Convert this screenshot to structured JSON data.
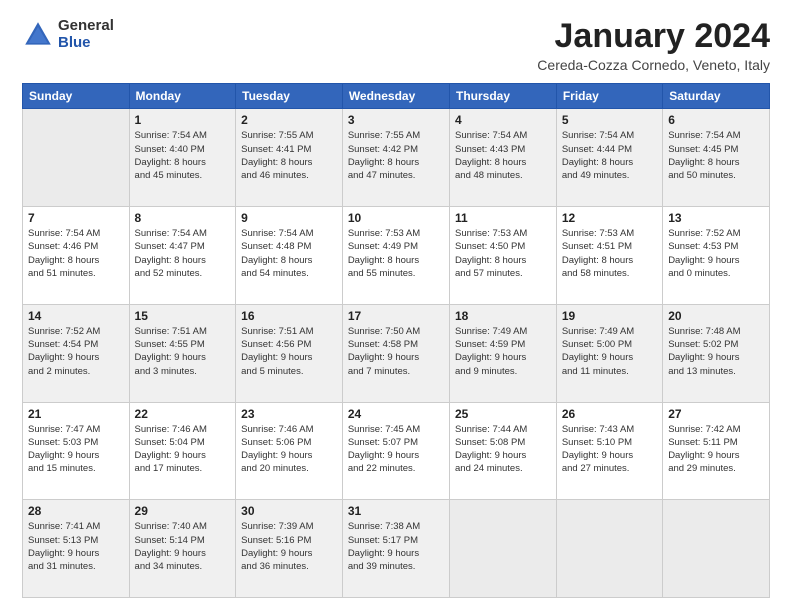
{
  "header": {
    "logo_general": "General",
    "logo_blue": "Blue",
    "month_title": "January 2024",
    "location": "Cereda-Cozza Cornedo, Veneto, Italy"
  },
  "weekdays": [
    "Sunday",
    "Monday",
    "Tuesday",
    "Wednesday",
    "Thursday",
    "Friday",
    "Saturday"
  ],
  "weeks": [
    [
      {
        "day": "",
        "info": ""
      },
      {
        "day": "1",
        "info": "Sunrise: 7:54 AM\nSunset: 4:40 PM\nDaylight: 8 hours\nand 45 minutes."
      },
      {
        "day": "2",
        "info": "Sunrise: 7:55 AM\nSunset: 4:41 PM\nDaylight: 8 hours\nand 46 minutes."
      },
      {
        "day": "3",
        "info": "Sunrise: 7:55 AM\nSunset: 4:42 PM\nDaylight: 8 hours\nand 47 minutes."
      },
      {
        "day": "4",
        "info": "Sunrise: 7:54 AM\nSunset: 4:43 PM\nDaylight: 8 hours\nand 48 minutes."
      },
      {
        "day": "5",
        "info": "Sunrise: 7:54 AM\nSunset: 4:44 PM\nDaylight: 8 hours\nand 49 minutes."
      },
      {
        "day": "6",
        "info": "Sunrise: 7:54 AM\nSunset: 4:45 PM\nDaylight: 8 hours\nand 50 minutes."
      }
    ],
    [
      {
        "day": "7",
        "info": "Sunrise: 7:54 AM\nSunset: 4:46 PM\nDaylight: 8 hours\nand 51 minutes."
      },
      {
        "day": "8",
        "info": "Sunrise: 7:54 AM\nSunset: 4:47 PM\nDaylight: 8 hours\nand 52 minutes."
      },
      {
        "day": "9",
        "info": "Sunrise: 7:54 AM\nSunset: 4:48 PM\nDaylight: 8 hours\nand 54 minutes."
      },
      {
        "day": "10",
        "info": "Sunrise: 7:53 AM\nSunset: 4:49 PM\nDaylight: 8 hours\nand 55 minutes."
      },
      {
        "day": "11",
        "info": "Sunrise: 7:53 AM\nSunset: 4:50 PM\nDaylight: 8 hours\nand 57 minutes."
      },
      {
        "day": "12",
        "info": "Sunrise: 7:53 AM\nSunset: 4:51 PM\nDaylight: 8 hours\nand 58 minutes."
      },
      {
        "day": "13",
        "info": "Sunrise: 7:52 AM\nSunset: 4:53 PM\nDaylight: 9 hours\nand 0 minutes."
      }
    ],
    [
      {
        "day": "14",
        "info": "Sunrise: 7:52 AM\nSunset: 4:54 PM\nDaylight: 9 hours\nand 2 minutes."
      },
      {
        "day": "15",
        "info": "Sunrise: 7:51 AM\nSunset: 4:55 PM\nDaylight: 9 hours\nand 3 minutes."
      },
      {
        "day": "16",
        "info": "Sunrise: 7:51 AM\nSunset: 4:56 PM\nDaylight: 9 hours\nand 5 minutes."
      },
      {
        "day": "17",
        "info": "Sunrise: 7:50 AM\nSunset: 4:58 PM\nDaylight: 9 hours\nand 7 minutes."
      },
      {
        "day": "18",
        "info": "Sunrise: 7:49 AM\nSunset: 4:59 PM\nDaylight: 9 hours\nand 9 minutes."
      },
      {
        "day": "19",
        "info": "Sunrise: 7:49 AM\nSunset: 5:00 PM\nDaylight: 9 hours\nand 11 minutes."
      },
      {
        "day": "20",
        "info": "Sunrise: 7:48 AM\nSunset: 5:02 PM\nDaylight: 9 hours\nand 13 minutes."
      }
    ],
    [
      {
        "day": "21",
        "info": "Sunrise: 7:47 AM\nSunset: 5:03 PM\nDaylight: 9 hours\nand 15 minutes."
      },
      {
        "day": "22",
        "info": "Sunrise: 7:46 AM\nSunset: 5:04 PM\nDaylight: 9 hours\nand 17 minutes."
      },
      {
        "day": "23",
        "info": "Sunrise: 7:46 AM\nSunset: 5:06 PM\nDaylight: 9 hours\nand 20 minutes."
      },
      {
        "day": "24",
        "info": "Sunrise: 7:45 AM\nSunset: 5:07 PM\nDaylight: 9 hours\nand 22 minutes."
      },
      {
        "day": "25",
        "info": "Sunrise: 7:44 AM\nSunset: 5:08 PM\nDaylight: 9 hours\nand 24 minutes."
      },
      {
        "day": "26",
        "info": "Sunrise: 7:43 AM\nSunset: 5:10 PM\nDaylight: 9 hours\nand 27 minutes."
      },
      {
        "day": "27",
        "info": "Sunrise: 7:42 AM\nSunset: 5:11 PM\nDaylight: 9 hours\nand 29 minutes."
      }
    ],
    [
      {
        "day": "28",
        "info": "Sunrise: 7:41 AM\nSunset: 5:13 PM\nDaylight: 9 hours\nand 31 minutes."
      },
      {
        "day": "29",
        "info": "Sunrise: 7:40 AM\nSunset: 5:14 PM\nDaylight: 9 hours\nand 34 minutes."
      },
      {
        "day": "30",
        "info": "Sunrise: 7:39 AM\nSunset: 5:16 PM\nDaylight: 9 hours\nand 36 minutes."
      },
      {
        "day": "31",
        "info": "Sunrise: 7:38 AM\nSunset: 5:17 PM\nDaylight: 9 hours\nand 39 minutes."
      },
      {
        "day": "",
        "info": ""
      },
      {
        "day": "",
        "info": ""
      },
      {
        "day": "",
        "info": ""
      }
    ]
  ]
}
